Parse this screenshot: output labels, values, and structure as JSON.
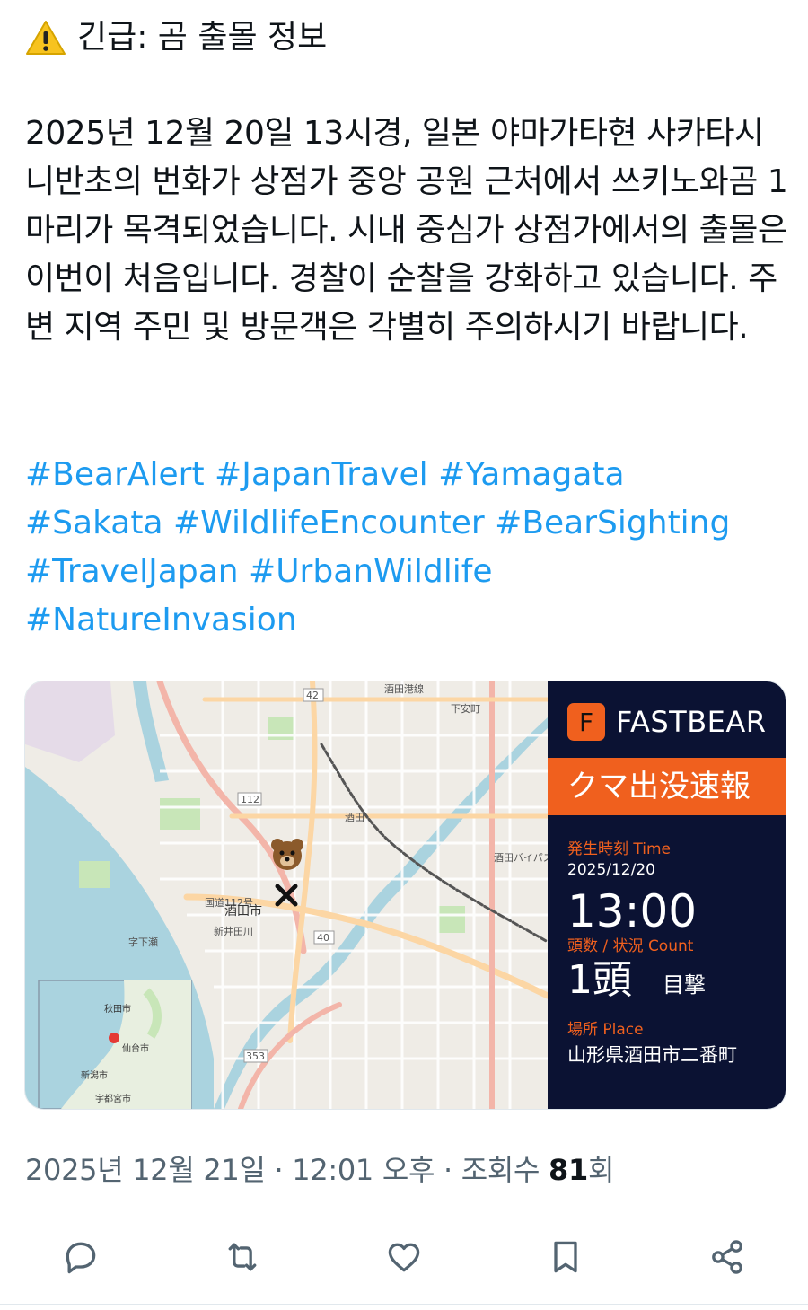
{
  "post": {
    "title_icon": "warning-icon",
    "title": "긴급: 곰 출몰 정보",
    "body": "2025년 12월 20일 13시경, 일본 야마가타현 사카타시 니반초의 번화가 상점가 중앙 공원 근처에서 쓰키노와곰 1마리가 목격되었습니다. 시내 중심가 상점가에서의 출몰은 이번이 처음입니다. 경찰이 순찰을 강화하고 있습니다. 주변 지역 주민 및 방문객은 각별히 주의하시기 바랍니다.",
    "hashtags": [
      "#BearAlert",
      "#JapanTravel",
      "#Yamagata",
      "#Sakata",
      "#WildlifeEncounter",
      "#BearSighting",
      "#TravelJapan",
      "#UrbanWildlife",
      "#NatureInvasion"
    ],
    "hashtag_color": "#1d9bf0"
  },
  "card": {
    "map": {
      "city_label": "酒田市",
      "road_labels": [
        "42",
        "112",
        "40",
        "353",
        "酒田港線",
        "下安町",
        "国道112号",
        "酒田バイパス",
        "新井田川",
        "酒田"
      ],
      "area_labels": [
        "字下瀬"
      ],
      "inset_labels": [
        "秋田市",
        "仙台市",
        "新潟市",
        "宇都宮市"
      ]
    },
    "panel": {
      "logo_letter": "F",
      "brand": "FASTBEAR",
      "banner": "クマ出没速報",
      "time_label": "発生時刻 Time",
      "date": "2025/12/20",
      "time": "13:00",
      "count_label": "頭数 / 状況 Count",
      "count": "1頭",
      "status": "目撃",
      "place_label": "場所 Place",
      "place": "山形県酒田市二番町",
      "accent_color": "#f0601e",
      "bg_color": "#0b1233"
    }
  },
  "meta": {
    "datetime": "2025년 12월 21일 · 12:01 오후 · 조회수 ",
    "views": "81",
    "views_suffix": "회"
  },
  "actions": [
    "reply-icon",
    "retweet-icon",
    "like-icon",
    "bookmark-icon",
    "share-icon"
  ]
}
